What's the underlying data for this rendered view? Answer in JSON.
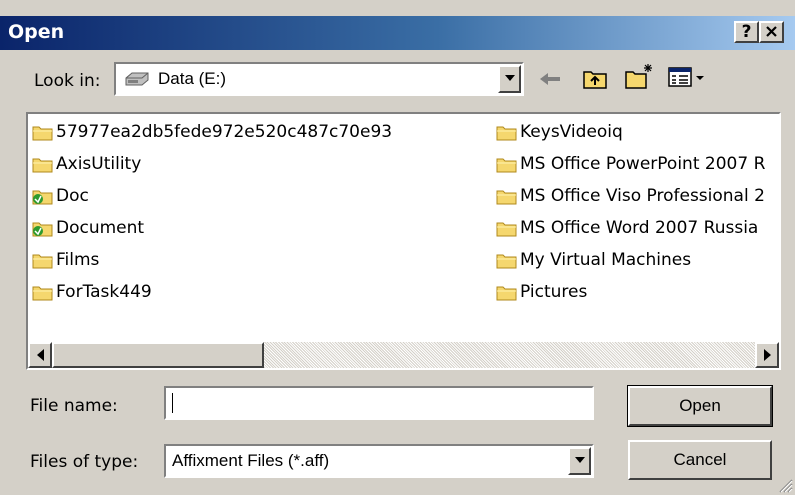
{
  "dialog": {
    "title": "Open",
    "help_label": "?",
    "close_label": "✕"
  },
  "look_in": {
    "label": "Look in:",
    "value": "Data (E:)",
    "icon": "drive-icon"
  },
  "toolbar": {
    "back": "back-arrow-icon",
    "up": "up-folder-icon",
    "new_folder": "new-folder-icon",
    "views": "view-menu-icon"
  },
  "files": {
    "col1": [
      {
        "name": "57977ea2db5fede972e520c487c70e93",
        "shared": false
      },
      {
        "name": "AxisUtility",
        "shared": false
      },
      {
        "name": "Doc",
        "shared": true
      },
      {
        "name": "Document",
        "shared": true
      },
      {
        "name": "Films",
        "shared": false
      },
      {
        "name": "ForTask449",
        "shared": false
      }
    ],
    "col2": [
      {
        "name": "KeysVideoiq",
        "shared": false
      },
      {
        "name": "MS Office PowerPoint 2007 R",
        "shared": false
      },
      {
        "name": "MS Office Viso Professional 2",
        "shared": false
      },
      {
        "name": "MS Office Word 2007 Russia",
        "shared": false
      },
      {
        "name": "My Virtual Machines",
        "shared": false
      },
      {
        "name": "Pictures",
        "shared": false
      }
    ]
  },
  "scrollbar": {
    "position_fraction": 0.0
  },
  "file_name": {
    "label": "File name:",
    "value": ""
  },
  "files_of_type": {
    "label": "Files of type:",
    "value": "Affixment Files (*.aff)"
  },
  "buttons": {
    "open": "Open",
    "cancel": "Cancel"
  },
  "colors": {
    "title_start": "#0a246a",
    "title_end": "#a6caf0",
    "face": "#d4d0c8",
    "folder": "#f5d76e"
  }
}
